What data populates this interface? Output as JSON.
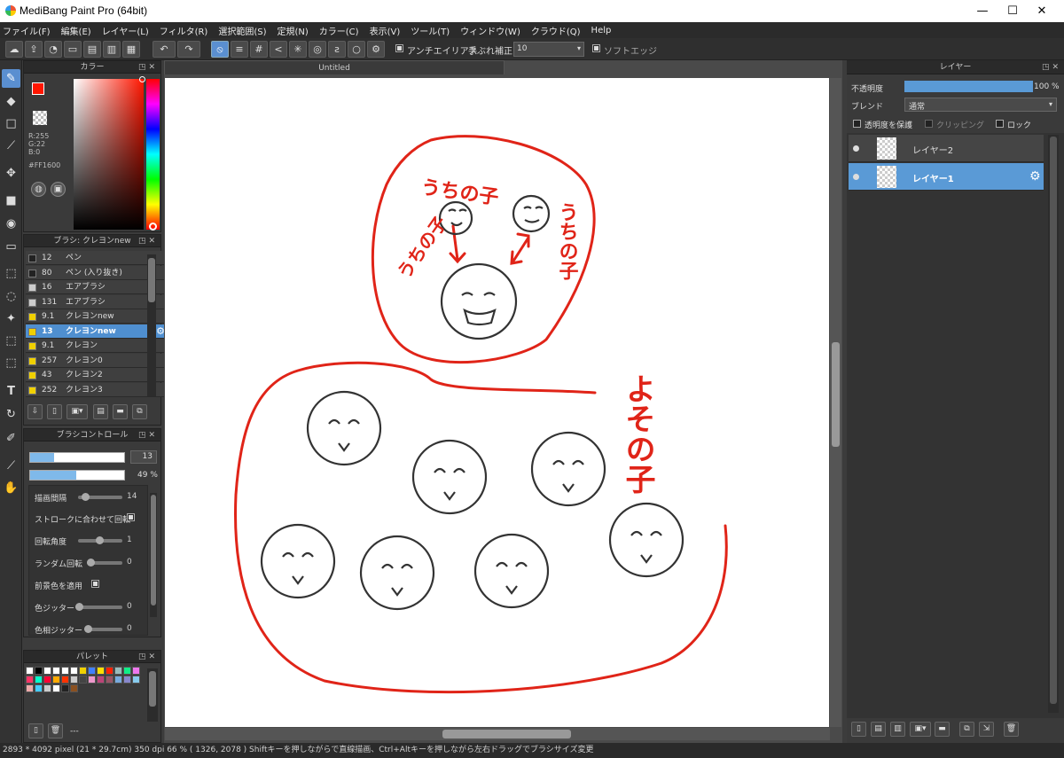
{
  "window": {
    "title": "MediBang Paint Pro (64bit)",
    "minimize": "—",
    "maximize": "☐",
    "close": "✕"
  },
  "menu": [
    "ファイル(F)",
    "編集(E)",
    "レイヤー(L)",
    "フィルタ(R)",
    "選択範囲(S)",
    "定規(N)",
    "カラー(C)",
    "表示(V)",
    "ツール(T)",
    "ウィンドウ(W)",
    "クラウド(Q)",
    "Help"
  ],
  "toolbar": {
    "antialias_label": "アンチエイリアス",
    "correction_label": "手ぶれ補正",
    "correction_value": "10",
    "softedge_label": "ソフトエッジ"
  },
  "color_panel": {
    "title": "カラー",
    "r": "R:255",
    "g": "G:22",
    "b": "B:0",
    "hex": "#FF1600",
    "fg": "#ff1600"
  },
  "brush_panel": {
    "title": "ブラシ: クレヨンnew",
    "items": [
      {
        "size": "12",
        "name": "ペン",
        "color": "#222222"
      },
      {
        "size": "80",
        "name": "ペン (入り抜き)",
        "color": "#222222"
      },
      {
        "size": "16",
        "name": "エアブラシ",
        "color": "#cccccc"
      },
      {
        "size": "131",
        "name": "エアブラシ",
        "color": "#cccccc"
      },
      {
        "size": "9.1",
        "name": "クレヨンnew",
        "color": "#f0d000"
      },
      {
        "size": "13",
        "name": "クレヨンnew",
        "color": "#f0d000"
      },
      {
        "size": "9.1",
        "name": "クレヨン",
        "color": "#f0d000"
      },
      {
        "size": "257",
        "name": "クレヨン0",
        "color": "#f0d000"
      },
      {
        "size": "43",
        "name": "クレヨン2",
        "color": "#f0d000"
      },
      {
        "size": "252",
        "name": "クレヨン3",
        "color": "#f0d000"
      }
    ]
  },
  "brush_control": {
    "title": "ブラシコントロール",
    "size_value": "13",
    "size_level": 0.25,
    "opacity_value": "49 %",
    "opacity_level": 0.49,
    "spacing_label": "描画間隔",
    "spacing_value": "14",
    "stroke_rotate_label": "ストロークに合わせて回転",
    "rotation_label": "回転角度",
    "rotation_value": "1",
    "random_rotation_label": "ランダム回転",
    "random_rotation_value": "0",
    "fg_color_label": "前景色を適用",
    "color_jitter_label": "色ジッター",
    "color_jitter_value": "0",
    "hue_jitter_label": "色相ジッター",
    "hue_jitter_value": "0"
  },
  "palette": {
    "title": "パレット",
    "colors": [
      "#ffffff",
      "#000000",
      "#ffffff",
      "#ffffff",
      "#ffffff",
      "#ffffff",
      "#f0d000",
      "#4080ff",
      "#ffe000",
      "#ff2000",
      "#9bb",
      "#1e8",
      "#e7e",
      "#f36",
      "#0fc",
      "#f03",
      "#fa0",
      "#f30",
      "#ccc",
      "#444",
      "#e9c",
      "#b47",
      "#956",
      "#7ad",
      "#88c",
      "#8ce",
      "#eaa",
      "#4cf",
      "#ccc",
      "#fff",
      "#222",
      "#8a5020"
    ],
    "footer": "---"
  },
  "document": {
    "tab": "Untitled"
  },
  "drawing": {
    "top_label": "うちの子",
    "right_label": "うちの子",
    "left_label": "うちの子",
    "side_label": "よその子"
  },
  "layer_panel": {
    "title": "レイヤー",
    "opacity_label": "不透明度",
    "opacity_value": "100 %",
    "opacity_level": 1.0,
    "blend_label": "ブレンド",
    "blend_value": "通常",
    "protect_label": "透明度を保護",
    "clipping_label": "クリッピング",
    "lock_label": "ロック",
    "layers": [
      {
        "name": "レイヤー2",
        "selected": false
      },
      {
        "name": "レイヤー1",
        "selected": true
      }
    ]
  },
  "status": "2893 * 4092 pixel  (21 * 29.7cm)  350 dpi  66 %  ( 1326, 2078 )  Shiftキーを押しながらで直線描画、Ctrl+Altキーを押しながら左右ドラッグでブラシサイズ変更"
}
